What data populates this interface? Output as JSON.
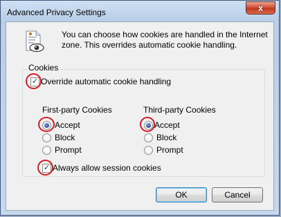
{
  "window": {
    "title": "Advanced Privacy Settings",
    "close_glyph": "x"
  },
  "intro": {
    "text": "You can choose how cookies are handled in the Internet zone.  This overrides automatic cookie handling.",
    "icon": "privacy-eye-document-icon"
  },
  "cookies": {
    "group_label": "Cookies",
    "override": {
      "label": "Override automatic cookie handling",
      "checked": true
    },
    "first_party": {
      "title": "First-party Cookies",
      "options": [
        {
          "label": "Accept",
          "selected": true
        },
        {
          "label": "Block",
          "selected": false
        },
        {
          "label": "Prompt",
          "selected": false
        }
      ]
    },
    "third_party": {
      "title": "Third-party Cookies",
      "options": [
        {
          "label": "Accept",
          "selected": true
        },
        {
          "label": "Block",
          "selected": false
        },
        {
          "label": "Prompt",
          "selected": false
        }
      ]
    },
    "session": {
      "label": "Always allow session cookies",
      "checked": true
    }
  },
  "buttons": {
    "ok": "OK",
    "cancel": "Cancel"
  },
  "colors": {
    "highlight_ring": "#d61b22",
    "close_button": "#c0391f"
  }
}
